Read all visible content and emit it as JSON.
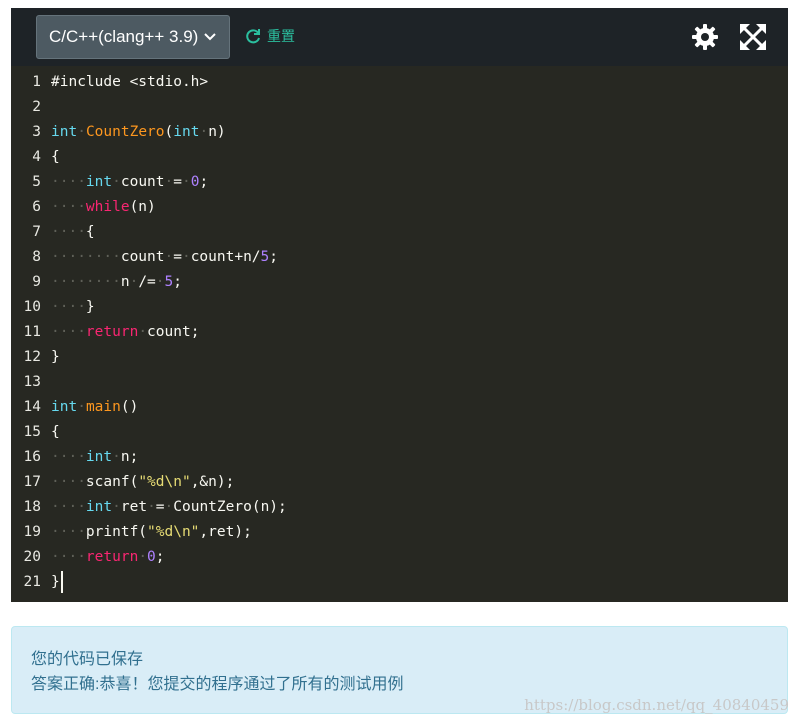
{
  "toolbar": {
    "language": "C/C++(clang++ 3.9)",
    "reset_label": "重置",
    "accent": "#2bbf9f",
    "icons": [
      "chevron-down-icon",
      "refresh-icon",
      "gear-icon",
      "fullscreen-icon"
    ]
  },
  "editor": {
    "theme_colors": {
      "background": "#272822",
      "type": "#66d9ef",
      "keyword": "#f92672",
      "function": "#fd971f",
      "number": "#ae81ff",
      "string": "#e6db74"
    },
    "lines": [
      {
        "n": "1",
        "tokens": [
          [
            "#include <stdio.h>",
            ""
          ]
        ]
      },
      {
        "n": "2",
        "tokens": []
      },
      {
        "n": "3",
        "tokens": [
          [
            "int",
            "kw-type"
          ],
          [
            "·",
            "ws"
          ],
          [
            "CountZero",
            "fn"
          ],
          [
            "(",
            ""
          ],
          [
            "int",
            "kw-type"
          ],
          [
            "·",
            "ws"
          ],
          [
            "n)",
            ""
          ]
        ]
      },
      {
        "n": "4",
        "tokens": [
          [
            "{",
            ""
          ]
        ]
      },
      {
        "n": "5",
        "tokens": [
          [
            "····",
            "ws"
          ],
          [
            "int",
            "kw-type"
          ],
          [
            "·",
            "ws"
          ],
          [
            "count",
            ""
          ],
          [
            "·",
            "ws"
          ],
          [
            "=",
            ""
          ],
          [
            "·",
            "ws"
          ],
          [
            "0",
            "num"
          ],
          [
            ";",
            ""
          ]
        ]
      },
      {
        "n": "6",
        "tokens": [
          [
            "····",
            "ws"
          ],
          [
            "while",
            "kw"
          ],
          [
            "(n)",
            ""
          ]
        ]
      },
      {
        "n": "7",
        "tokens": [
          [
            "····",
            "ws"
          ],
          [
            "{",
            ""
          ]
        ]
      },
      {
        "n": "8",
        "tokens": [
          [
            "········",
            "ws"
          ],
          [
            "count",
            ""
          ],
          [
            "·",
            "ws"
          ],
          [
            "=",
            ""
          ],
          [
            "·",
            "ws"
          ],
          [
            "count+n/",
            ""
          ],
          [
            "5",
            "num"
          ],
          [
            ";",
            ""
          ]
        ]
      },
      {
        "n": "9",
        "tokens": [
          [
            "········",
            "ws"
          ],
          [
            "n",
            ""
          ],
          [
            "·",
            "ws"
          ],
          [
            "/=",
            ""
          ],
          [
            "·",
            "ws"
          ],
          [
            "5",
            "num"
          ],
          [
            ";",
            ""
          ]
        ]
      },
      {
        "n": "10",
        "tokens": [
          [
            "····",
            "ws"
          ],
          [
            "}",
            ""
          ]
        ]
      },
      {
        "n": "11",
        "tokens": [
          [
            "····",
            "ws"
          ],
          [
            "return",
            "kw"
          ],
          [
            "·",
            "ws"
          ],
          [
            "count;",
            ""
          ]
        ]
      },
      {
        "n": "12",
        "tokens": [
          [
            "}",
            ""
          ]
        ]
      },
      {
        "n": "13",
        "tokens": []
      },
      {
        "n": "14",
        "tokens": [
          [
            "int",
            "kw-type"
          ],
          [
            "·",
            "ws"
          ],
          [
            "main",
            "fn"
          ],
          [
            "()",
            ""
          ]
        ]
      },
      {
        "n": "15",
        "tokens": [
          [
            "{",
            ""
          ]
        ]
      },
      {
        "n": "16",
        "tokens": [
          [
            "····",
            "ws"
          ],
          [
            "int",
            "kw-type"
          ],
          [
            "·",
            "ws"
          ],
          [
            "n;",
            ""
          ]
        ]
      },
      {
        "n": "17",
        "tokens": [
          [
            "····",
            "ws"
          ],
          [
            "scanf(",
            ""
          ],
          [
            "\"%d\\n\"",
            "str"
          ],
          [
            ",&n);",
            ""
          ]
        ]
      },
      {
        "n": "18",
        "tokens": [
          [
            "····",
            "ws"
          ],
          [
            "int",
            "kw-type"
          ],
          [
            "·",
            "ws"
          ],
          [
            "ret",
            ""
          ],
          [
            "·",
            "ws"
          ],
          [
            "=",
            ""
          ],
          [
            "·",
            "ws"
          ],
          [
            "CountZero(n);",
            ""
          ]
        ]
      },
      {
        "n": "19",
        "tokens": [
          [
            "····",
            "ws"
          ],
          [
            "printf(",
            ""
          ],
          [
            "\"%d\\n\"",
            "str"
          ],
          [
            ",ret);",
            ""
          ]
        ]
      },
      {
        "n": "20",
        "tokens": [
          [
            "····",
            "ws"
          ],
          [
            "return",
            "kw"
          ],
          [
            "·",
            "ws"
          ],
          [
            "0",
            "num"
          ],
          [
            ";",
            ""
          ]
        ]
      },
      {
        "n": "21",
        "tokens": [
          [
            "}",
            ""
          ]
        ]
      }
    ]
  },
  "result": {
    "saved_msg": "您的代码已保存",
    "success_msg": "答案正确:恭喜！您提交的程序通过了所有的测试用例"
  },
  "watermark": "https://blog.csdn.net/qq_40840459"
}
